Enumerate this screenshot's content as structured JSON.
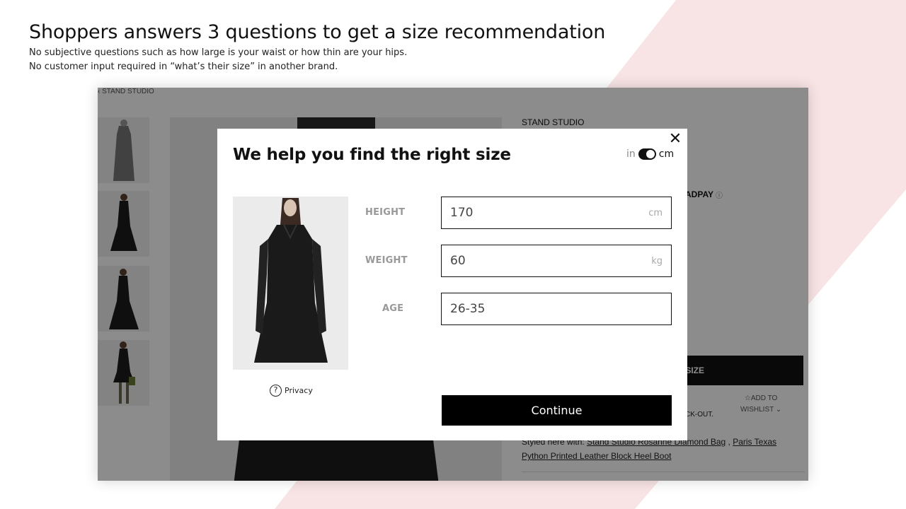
{
  "slide": {
    "title": "Shoppers answers 3 questions to get a size recommendation",
    "subtitle_line1": "No subjective questions such as how large is your waist or how thin are your hips.",
    "subtitle_line2": "No customer input required in “what’s their size” in another brand."
  },
  "pdp": {
    "breadcrumb": "‹  STAND STUDIO",
    "brand": "STAND STUDIO",
    "payment_label": "ADPAY",
    "size_button_partial": "A SIZE",
    "checkout_partial": "CK-OUT.",
    "wishlist_line1": "ADD TO",
    "wishlist_line2": "WISHLIST",
    "styled_prefix": "Styled here with:",
    "styled_item1": "Stand Studio Rosanne Diamond Bag",
    "styled_separator": " , ",
    "styled_item2": "Paris Texas Python Printed Leather Block Heel Boot"
  },
  "modal": {
    "title": "We help you find the right size",
    "unit_toggle": {
      "left": "in",
      "right": "cm",
      "selected": "cm"
    },
    "privacy_label": "Privacy",
    "continue_label": "Continue",
    "fields": {
      "height": {
        "label": "HEIGHT",
        "value": "170",
        "unit": "cm"
      },
      "weight": {
        "label": "WEIGHT",
        "value": "60",
        "unit": "kg"
      },
      "age": {
        "label": "AGE",
        "value": "26-35"
      }
    }
  },
  "icons": {
    "close": "close-icon",
    "privacy": "question-circle-icon",
    "wishlist": "star-outline-icon",
    "info": "info-icon",
    "toggle": "toggle-switch-icon"
  },
  "colors": {
    "accent": "#000000",
    "overlay": "#6b6b6b",
    "background_stripe": "#f8e4e4"
  }
}
